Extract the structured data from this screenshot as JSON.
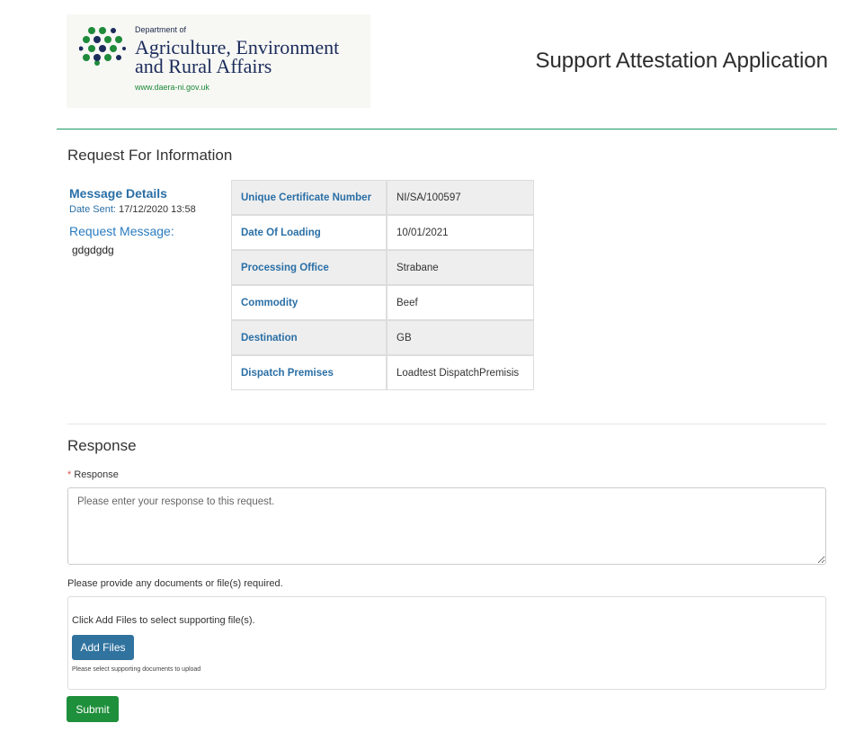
{
  "header": {
    "logo": {
      "dept_prefix": "Department of",
      "line1": "Agriculture, Environment",
      "line2": "and Rural Affairs",
      "url": "www.daera-ni.gov.uk"
    },
    "app_title": "Support Attestation Application"
  },
  "rfi": {
    "title": "Request For Information",
    "message_heading": "Message Details",
    "date_label": "Date Sent:",
    "date_value": "17/12/2020 13:58",
    "request_label": "Request Message:",
    "request_text": "gdgdgdg",
    "details": [
      {
        "label": "Unique Certificate Number",
        "value": "NI/SA/100597"
      },
      {
        "label": "Date Of Loading",
        "value": "10/01/2021"
      },
      {
        "label": "Processing Office",
        "value": "Strabane"
      },
      {
        "label": "Commodity",
        "value": "Beef"
      },
      {
        "label": "Destination",
        "value": "GB"
      },
      {
        "label": "Dispatch Premises",
        "value": "Loadtest DispatchPremisis"
      }
    ]
  },
  "response": {
    "title": "Response",
    "required_mark": "*",
    "field_label": "Response",
    "value": "",
    "placeholder": "Please enter your response to this request.",
    "docs_label": "Please provide any documents or file(s) required.",
    "upload_hint": "Click Add Files to select supporting file(s).",
    "add_files_label": "Add Files",
    "upload_note": "Please select supporting documents to upload",
    "submit_label": "Submit"
  },
  "colors": {
    "accent_blue": "#2a6fa6",
    "add_button": "#31739f",
    "submit_button": "#1e8f3b",
    "header_rule": "#1e9a66",
    "logo_green": "#1e8a3a"
  }
}
